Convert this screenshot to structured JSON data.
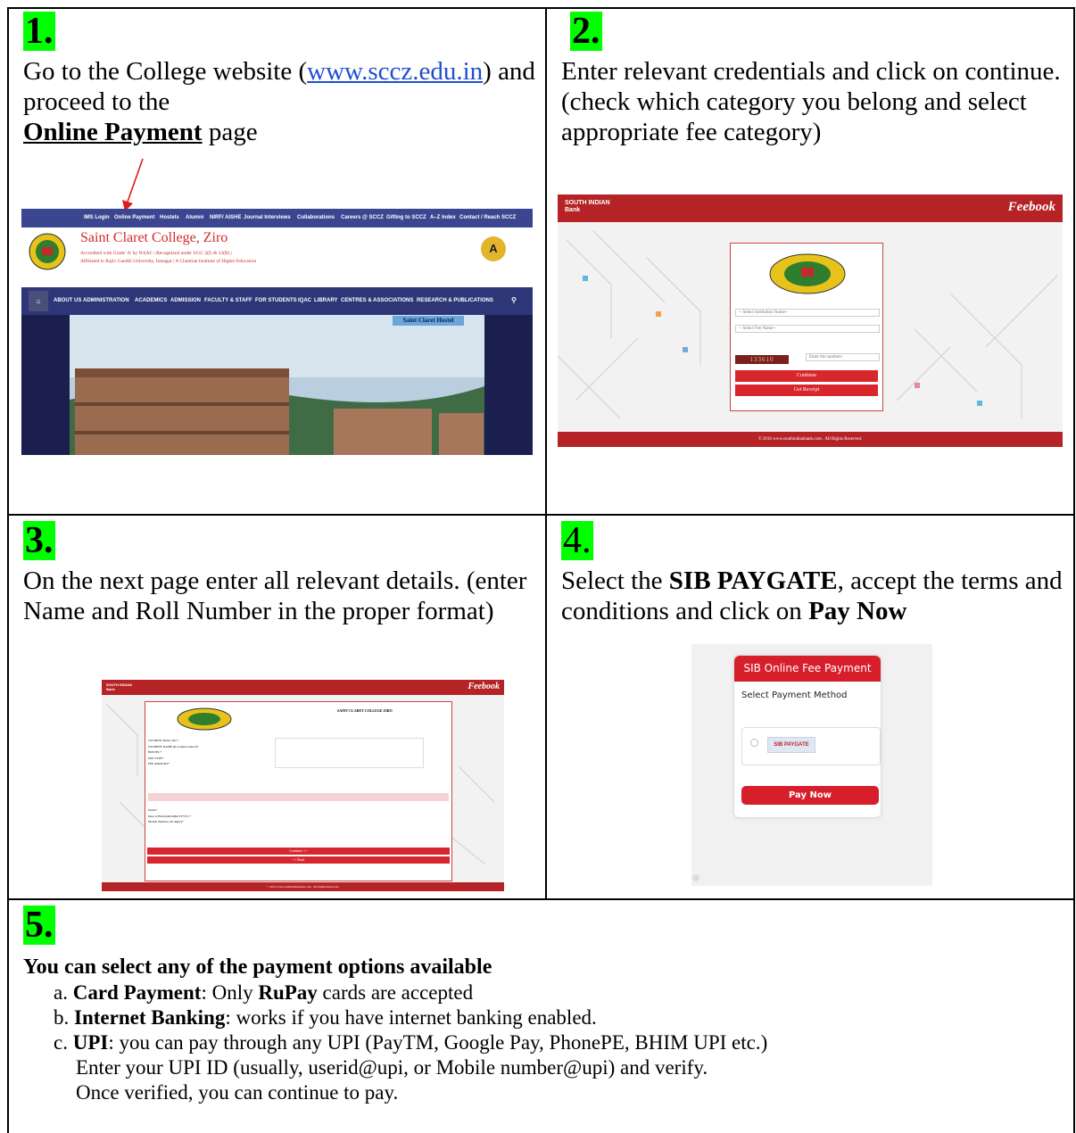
{
  "steps": {
    "s1": {
      "number": "1.",
      "text_a": "Go to the College website (",
      "link": "www.sccz.edu.in",
      "text_b": ") and proceed to the",
      "bold": "Online Payment",
      "text_c": " page",
      "screenshot": {
        "nav_items": [
          "IMS Login",
          "Online Payment",
          "Hostels",
          "Alumni",
          "NIRF/ AISHE",
          "Journal Interviews",
          "Collaborations",
          "Careers @ SCCZ",
          "Gifting to SCCZ",
          "A–Z Index",
          "Contact / Reach SCCZ"
        ],
        "college_name": "Saint Claret College, Ziro",
        "accreditation": "Accredited with Grade 'A' by NAAC | Recognized under UGC 2(f) & 12(B) |",
        "affiliation": "Affiliated to Rajiv Gandhi University, Itanagar | A Claretian Institute of Higher Education",
        "naac_badge": "A",
        "menu_items": [
          "ABOUT US",
          "ADMINISTRATION",
          "ACADEMICS",
          "ADMISSION",
          "FACULTY & STAFF",
          "FOR STUDENTS",
          "IQAC",
          "LIBRARY",
          "CENTRES & ASSOCIATIONS",
          "RESEARCH & PUBLICATIONS"
        ],
        "photo_caption": "Saint Claret Hostel"
      }
    },
    "s2": {
      "number": "2.",
      "text": "Enter relevant credentials and click on continue. (check which category you belong and select appropriate fee category)",
      "screenshot": {
        "bank": "SOUTH INDIAN Bank",
        "brand": "Feebook",
        "select_institution": "-- Select Institution Name--",
        "select_fee": "-- Select Fee Name--",
        "captcha": "133610",
        "captcha_placeholder": "Enter the numbers",
        "continue": "Continue",
        "receipt": "Get Receipt",
        "footer": "© 2016 www.southindianbank.com . All Rights Reserved."
      }
    },
    "s3": {
      "number": "3.",
      "text": "On the next page enter all relevant details. (enter Name and Roll Number in the proper format)",
      "screenshot": {
        "college": "SAINT CLARET COLLEGE ZIRO",
        "fields": [
          "STUDENT ROLL NO *",
          "STUDENT NAME (In Capital Letters)*",
          "HOSTEL*",
          "FEE TYPE*",
          "FEE AMOUNT*"
        ],
        "fields2": [
          "Name*",
          "Date of Birth (DD-MM-YYYY) *",
          "Mobile Number (10 digits)*"
        ],
        "continue": "Continue >>",
        "back": "<< Back",
        "footer": "© 2016 www.southindianbank.com . All Rights Reserved."
      }
    },
    "s4": {
      "number": "4.",
      "text_a": "Select the ",
      "bold_a": "SIB PAYGATE",
      "text_b": ", accept the terms and conditions and click on ",
      "bold_b": "Pay Now",
      "screenshot": {
        "title": "SIB Online Fee Payment",
        "subtitle": "Select Payment Method",
        "option": "SIB PAYGATE",
        "button": "Pay Now"
      }
    },
    "s5": {
      "number": "5.",
      "heading": "You can select any of the payment options available",
      "items": [
        {
          "letter": "a.",
          "bold": "Card Payment",
          "text_a": ": Only ",
          "bold_b": "RuPay",
          "text_b": " cards are accepted"
        },
        {
          "letter": "b.",
          "bold": "Internet Banking",
          "text_a": ": works if you have internet banking enabled."
        },
        {
          "letter": "c.",
          "bold": "UPI",
          "text_a": ": you can pay through any UPI (PayTM, Google Pay, PhonePE, BHIM UPI etc.)"
        }
      ],
      "upi_line2": "Enter your UPI ID (usually, userid@upi, or Mobile number@upi) and verify.",
      "upi_line3": "Once verified, you can continue to pay."
    }
  },
  "colors": {
    "highlight": "#00ff00",
    "link": "#1f4fd1",
    "bank_red": "#b52326",
    "arrow": "#e01b1b"
  }
}
